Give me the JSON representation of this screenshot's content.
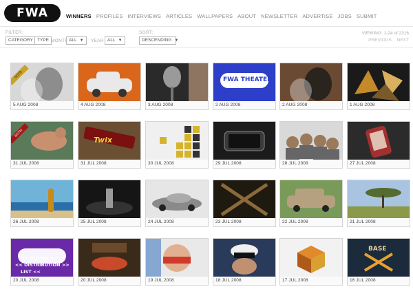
{
  "header": {
    "logo_text": "FWA",
    "nav": [
      "WINNERS",
      "PROFILES",
      "INTERVIEWS",
      "ARTICLES",
      "WALLPAPERS",
      "ABOUT",
      "NEWSLETTER",
      "ADVERTISE",
      "JOBS",
      "SUBMIT"
    ],
    "active_nav": "WINNERS"
  },
  "filter": {
    "filter_label": "FILTER:",
    "category": "CATEGORY",
    "type": "TYPE",
    "month_label": "MONTH",
    "month_value": "ALL",
    "year_label": "YEAR",
    "year_value": "ALL",
    "sort_label": "SORT:",
    "sort_value": "DESCENDING",
    "viewing": "VIEWING: 1-24 of 2316",
    "previous": "PREVIOUS",
    "next": "NEXT"
  },
  "tiles": [
    {
      "date": "5 AUG 2008",
      "badge": "SOTD",
      "bg": "#d8d8d8",
      "fg": "#7a7a7a",
      "art": "face"
    },
    {
      "date": "4 AUG 2008",
      "bg": "#d9661a",
      "fg": "#e9e9e9",
      "art": "car"
    },
    {
      "date": "3 AUG 2008",
      "bg": "#2a2a2a",
      "fg": "#9a9a9a",
      "art": "mic"
    },
    {
      "date": "2 AUG 2008",
      "bg": "#2d3fc8",
      "fg": "#ffffff",
      "art": "fwa",
      "word": "FWA THEATER"
    },
    {
      "date": "2 AUG 2008",
      "bg": "#6a4a33",
      "fg": "#1a1a1a",
      "art": "face"
    },
    {
      "date": "1 AUG 2008",
      "bg": "#1a1a1a",
      "fg": "#c48a2a",
      "art": "shards"
    },
    {
      "date": "31 JUL 2008",
      "badge": "SOTM",
      "bg": "#5a7a5a",
      "fg": "#c99070",
      "art": "runner"
    },
    {
      "date": "31 JUL 2008",
      "bg": "#6a4f33",
      "fg": "#b01a1a",
      "art": "bar",
      "word": "Twix"
    },
    {
      "date": "30 JUL 2008",
      "bg": "#f0f0f0",
      "fg": "#d6b42a",
      "art": "blocks"
    },
    {
      "date": "29 JUL 2008",
      "bg": "#1b1b1b",
      "fg": "#555555",
      "art": "phone"
    },
    {
      "date": "28 JUL 2008",
      "bg": "#d9d9d9",
      "fg": "#9a7a5a",
      "art": "people"
    },
    {
      "date": "27 JUL 2008",
      "bg": "#2b2b2b",
      "fg": "#a23030",
      "art": "hand"
    },
    {
      "date": "26 JUL 2008",
      "bg": "#6fb4d8",
      "fg": "#f2d9a0",
      "art": "beach"
    },
    {
      "date": "25 JUL 2008",
      "bg": "#151515",
      "fg": "#9a9a9a",
      "art": "scene"
    },
    {
      "date": "24 JUL 2008",
      "bg": "#e6e6e6",
      "fg": "#8a8a8a",
      "art": "car2"
    },
    {
      "date": "23 JUL 2008",
      "bg": "#1f1a10",
      "fg": "#8a6a3a",
      "art": "x"
    },
    {
      "date": "22 JUL 2008",
      "bg": "#7a9a5a",
      "fg": "#b5a080",
      "art": "car3"
    },
    {
      "date": "21 JUL 2008",
      "bg": "#a9c4e0",
      "fg": "#556b2f",
      "art": "tree"
    },
    {
      "date": "20 JUL 2008",
      "bg": "#6a2aa8",
      "fg": "#ffffff",
      "art": "dist",
      "word": "FWA"
    },
    {
      "date": "20 JUL 2008",
      "bg": "#3a2a1a",
      "fg": "#c84a2a",
      "art": "food"
    },
    {
      "date": "19 JUL 2008",
      "bg": "#e9e9e9",
      "fg": "#d13a2a",
      "art": "paint"
    },
    {
      "date": "18 JUL 2008",
      "bg": "#2a3a5a",
      "fg": "#f0f0f0",
      "art": "cyclist"
    },
    {
      "date": "17 JUL 2008",
      "bg": "#f2f2f2",
      "fg": "#e08a2a",
      "art": "cube"
    },
    {
      "date": "16 JUL 2008",
      "bg": "#1b2b3b",
      "fg": "#e8d0a0",
      "art": "base",
      "word": "BASE"
    }
  ],
  "dist_lines": [
    ">> GLOBAL <<",
    "<< DISTRIBUTION >>",
    "LIST <<"
  ]
}
